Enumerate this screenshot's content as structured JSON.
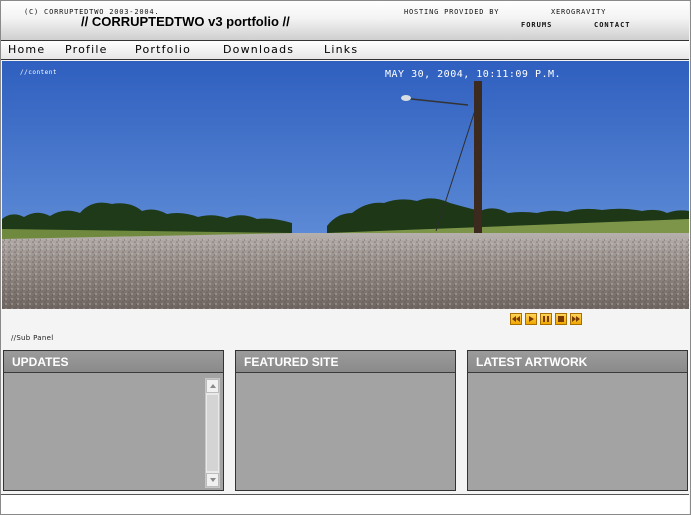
{
  "header": {
    "title": "// CORRUPTEDTWO v3 portfolio //",
    "links": [
      "Forums",
      "Contact"
    ]
  },
  "nav": {
    "items": [
      "Home",
      "Profile",
      "Portfolio",
      "Downloads",
      "Links"
    ]
  },
  "photo": {
    "content_tag": "//content",
    "datetime": "May 30, 2004, 10:11:09 p.m."
  },
  "controls": [
    "rewind-icon",
    "play-icon",
    "pause-icon",
    "stop-icon",
    "fast-forward-icon"
  ],
  "subpanel": {
    "label": "//Sub Panel",
    "panels": {
      "updates": "UPDATES",
      "featured": "FEATURED SITE",
      "artwork": "LATEST ARTWORK"
    }
  },
  "footer": {
    "copyright": "(c) corruptedtwo 2003-2004.",
    "hosting": "hosting provided by",
    "host_name": "xerogravity"
  },
  "colors": {
    "sky": "#3f6fc7",
    "panel": "#a3a3a3",
    "panel_head": "#919191",
    "control_accent": "#f0a800"
  }
}
